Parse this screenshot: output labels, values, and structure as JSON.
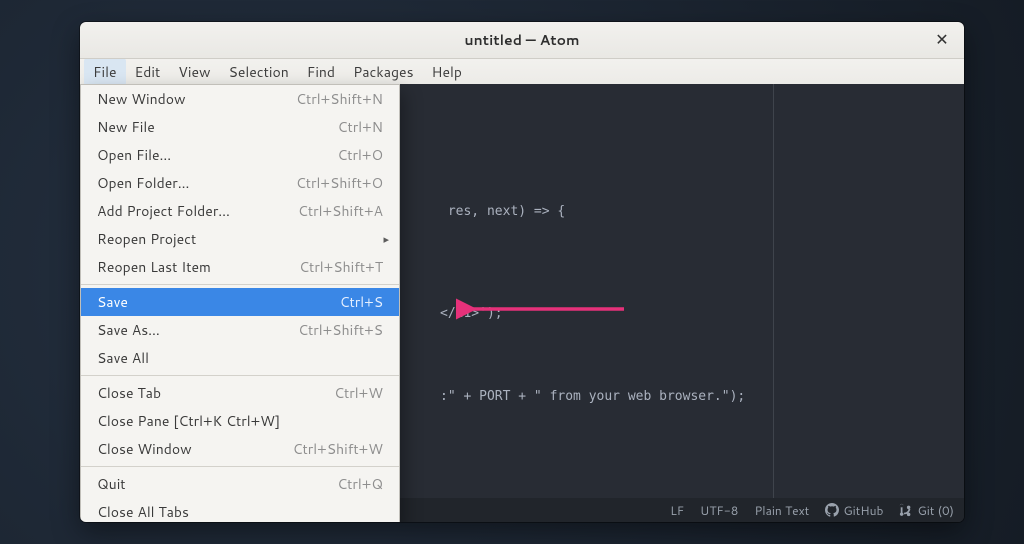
{
  "window": {
    "title": "untitled — Atom"
  },
  "menubar": [
    "File",
    "Edit",
    "View",
    "Selection",
    "Find",
    "Packages",
    "Help"
  ],
  "file_menu": {
    "groups": [
      [
        {
          "label": "New Window",
          "shortcut": "Ctrl+Shift+N"
        },
        {
          "label": "New File",
          "shortcut": "Ctrl+N"
        },
        {
          "label": "Open File…",
          "shortcut": "Ctrl+O"
        },
        {
          "label": "Open Folder…",
          "shortcut": "Ctrl+Shift+O"
        },
        {
          "label": "Add Project Folder…",
          "shortcut": "Ctrl+Shift+A"
        },
        {
          "label": "Reopen Project",
          "shortcut": "",
          "submenu": true
        },
        {
          "label": "Reopen Last Item",
          "shortcut": "Ctrl+Shift+T"
        }
      ],
      [
        {
          "label": "Save",
          "shortcut": "Ctrl+S",
          "selected": true
        },
        {
          "label": "Save As…",
          "shortcut": "Ctrl+Shift+S"
        },
        {
          "label": "Save All",
          "shortcut": ""
        }
      ],
      [
        {
          "label": "Close Tab",
          "shortcut": "Ctrl+W"
        },
        {
          "label": "Close Pane [Ctrl+K Ctrl+W]",
          "shortcut": ""
        },
        {
          "label": "Close Window",
          "shortcut": "Ctrl+Shift+W"
        }
      ],
      [
        {
          "label": "Quit",
          "shortcut": "Ctrl+Q"
        },
        {
          "label": "Close All Tabs",
          "shortcut": ""
        }
      ]
    ]
  },
  "code_fragments": {
    "l1": " res, next) => {",
    "l2": "</h1>');",
    "l3": ":\" + PORT + \" from your web browser.\");"
  },
  "statusbar": {
    "line_ending": "LF",
    "encoding": "UTF-8",
    "grammar": "Plain Text",
    "github_label": "GitHub",
    "git_label": "Git (0)"
  }
}
